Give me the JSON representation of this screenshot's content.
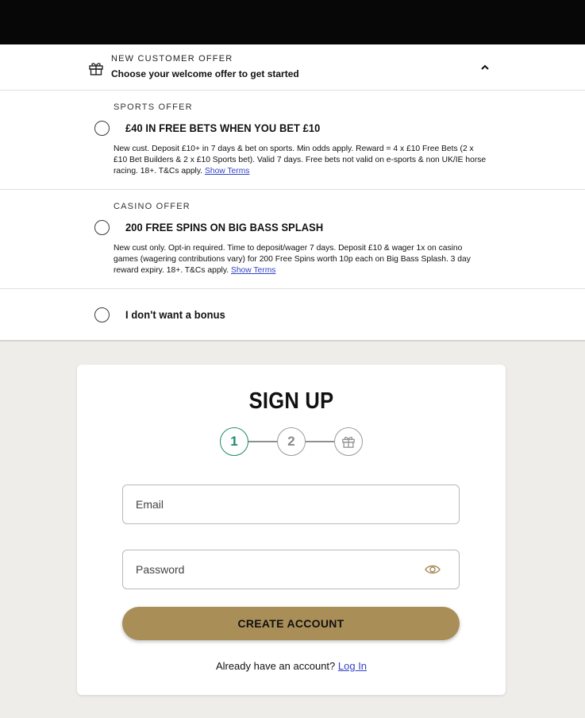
{
  "offer_panel": {
    "eyebrow": "NEW CUSTOMER OFFER",
    "subtitle": "Choose your welcome offer to get started",
    "icons": {
      "gift": "gift-icon",
      "toggle": "chevron-up-icon"
    },
    "offers": [
      {
        "eyebrow": "SPORTS OFFER",
        "title": "£40 IN FREE BETS WHEN YOU BET £10",
        "description": "New cust. Deposit £10+ in 7 days & bet on sports. Min odds apply. Reward = 4 x £10 Free Bets (2 x £10 Bet Builders & 2 x £10 Sports bet). Valid 7 days. Free bets not valid on e-sports & non UK/IE horse racing. 18+. T&Cs apply.",
        "terms_link": "Show Terms"
      },
      {
        "eyebrow": "CASINO OFFER",
        "title": "200 FREE SPINS ON BIG BASS SPLASH",
        "description": "New cust only. Opt-in required. Time to deposit/wager 7 days. Deposit £10 & wager 1x on casino games (wagering contributions vary) for 200 Free Spins worth 10p each on Big Bass Splash. 3 day reward expiry. 18+. T&Cs apply.",
        "terms_link": "Show Terms"
      },
      {
        "title": "I don't want a bonus"
      }
    ]
  },
  "signup": {
    "title": "SIGN UP",
    "steps": [
      "1",
      "2"
    ],
    "email_placeholder": "Email",
    "password_placeholder": "Password",
    "create_button": "CREATE ACCOUNT",
    "login_prompt": "Already have an account?",
    "login_link": "Log In"
  },
  "colors": {
    "accent_gold": "#a98e58",
    "step_active": "#1e8a6e",
    "link": "#3343c4",
    "page_bg": "#efede9"
  }
}
